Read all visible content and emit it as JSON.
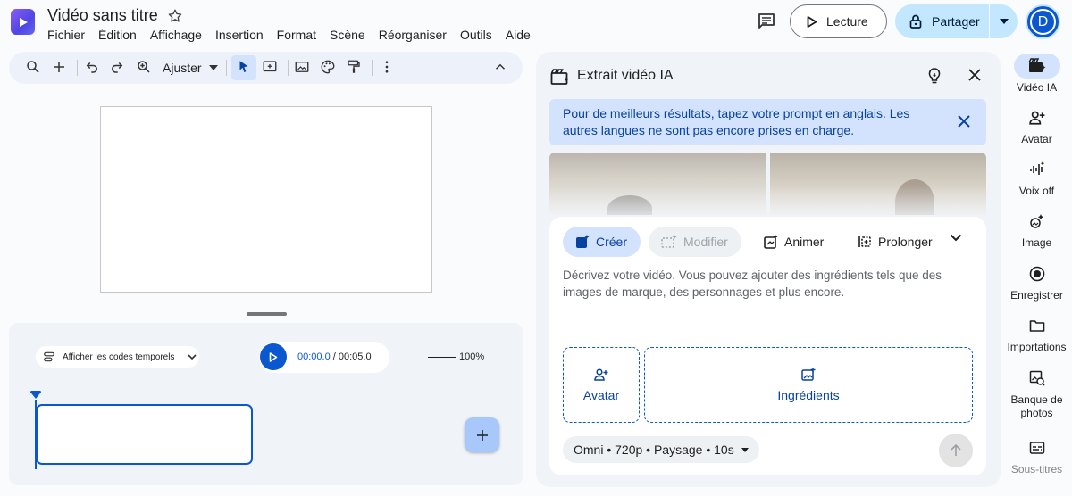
{
  "header": {
    "doc_title": "Vidéo sans titre",
    "menu": [
      "Fichier",
      "Édition",
      "Affichage",
      "Insertion",
      "Format",
      "Scène",
      "Réorganiser",
      "Outils",
      "Aide"
    ],
    "play_label": "Lecture",
    "share_label": "Partager",
    "avatar_letter": "D"
  },
  "toolbar": {
    "zoom_label": "Ajuster",
    "icons": [
      "search-icon",
      "add-icon",
      "undo-icon",
      "redo-icon",
      "zoom-icon",
      "select-icon",
      "text-box-icon",
      "image-icon",
      "palette-icon",
      "paint-format-icon",
      "more-icon",
      "collapse-icon"
    ]
  },
  "timeline": {
    "timecode_toggle_label": "Afficher les codes temporels",
    "current_time": "00:00.0",
    "time_separator": " / ",
    "total_time": "00:05.0",
    "zoom_percent": "100%"
  },
  "panel": {
    "title": "Extrait vidéo IA",
    "info_banner": "Pour de meilleurs résultats, tapez votre prompt en anglais. Les autres langues ne sont pas encore prises en charge.",
    "tabs": [
      {
        "label": "Créer",
        "state": "selected"
      },
      {
        "label": "Modifier",
        "state": "disabled"
      },
      {
        "label": "Animer",
        "state": "normal"
      },
      {
        "label": "Prolonger",
        "state": "normal"
      }
    ],
    "prompt_placeholder": "Décrivez votre vidéo. Vous pouvez ajouter des ingrédients tels que des images de marque, des personnages et plus encore.",
    "avatar_chip": "Avatar",
    "ingredients_chip": "Ingrédients",
    "settings_chip": "Omni • 720p • Paysage • 10s"
  },
  "rail": [
    {
      "label": "Vidéo IA",
      "icon": "ai-video-icon",
      "active": true
    },
    {
      "label": "Avatar",
      "icon": "avatar-add-icon"
    },
    {
      "label": "Voix off",
      "icon": "voiceover-icon"
    },
    {
      "label": "Image",
      "icon": "image-sparkle-icon"
    },
    {
      "label": "Enregistrer",
      "icon": "record-icon"
    },
    {
      "label": "Importations",
      "icon": "folder-icon"
    },
    {
      "label": "Banque de photos",
      "icon": "stock-photo-icon"
    },
    {
      "label": "Sous-titres",
      "icon": "subtitles-icon",
      "dim": true
    }
  ],
  "colors": {
    "accent": "#0b57d0",
    "accent_light": "#d3e3fd",
    "share_bg": "#c2e7ff",
    "panel_bg": "#f0f4f9"
  }
}
